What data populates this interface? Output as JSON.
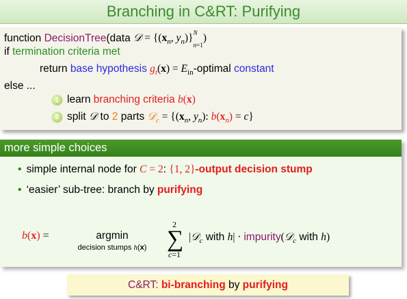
{
  "slide": {
    "title": "Branching in C&RT: Purifying"
  },
  "algorithm": {
    "line1_prefix": "function ",
    "line1_name": "DecisionTree",
    "line1_args": "(data ",
    "line2_if": "if ",
    "line2_condition": "termination criteria met",
    "line3_return": "return ",
    "line3_base": "base hypothesis",
    "line3_mid": "-optimal ",
    "line3_const": "constant",
    "line4_else": "else ...",
    "step1_num": "1",
    "step1_text": "learn ",
    "step1_criteria": "branching criteria",
    "step2_num": "2",
    "step2_text": "split ",
    "step2_to": " to ",
    "step2_count": "2",
    "step2_parts": " parts "
  },
  "choices": {
    "header": "more simple choices",
    "bullet1_text": "simple internal node for ",
    "bullet1_stump": "-output decision stump",
    "bullet2_text": "‘easier’ sub-tree: branch by ",
    "bullet2_emph": "purifying",
    "formula_argmin": "argmin",
    "formula_sub": "decision stumps",
    "formula_with_h": "with",
    "formula_impurity": "impurity"
  },
  "summary": {
    "lead": "C&RT: ",
    "bi": "bi-branching",
    "by": " by ",
    "purifying": "purifying"
  },
  "colors": {
    "title_green": "#3d8a2e",
    "header_green": "#3a8a20",
    "red": "#e21d1d",
    "blue": "#2a2ae0",
    "purple": "#8a1a6a",
    "orange": "#f07d10"
  }
}
